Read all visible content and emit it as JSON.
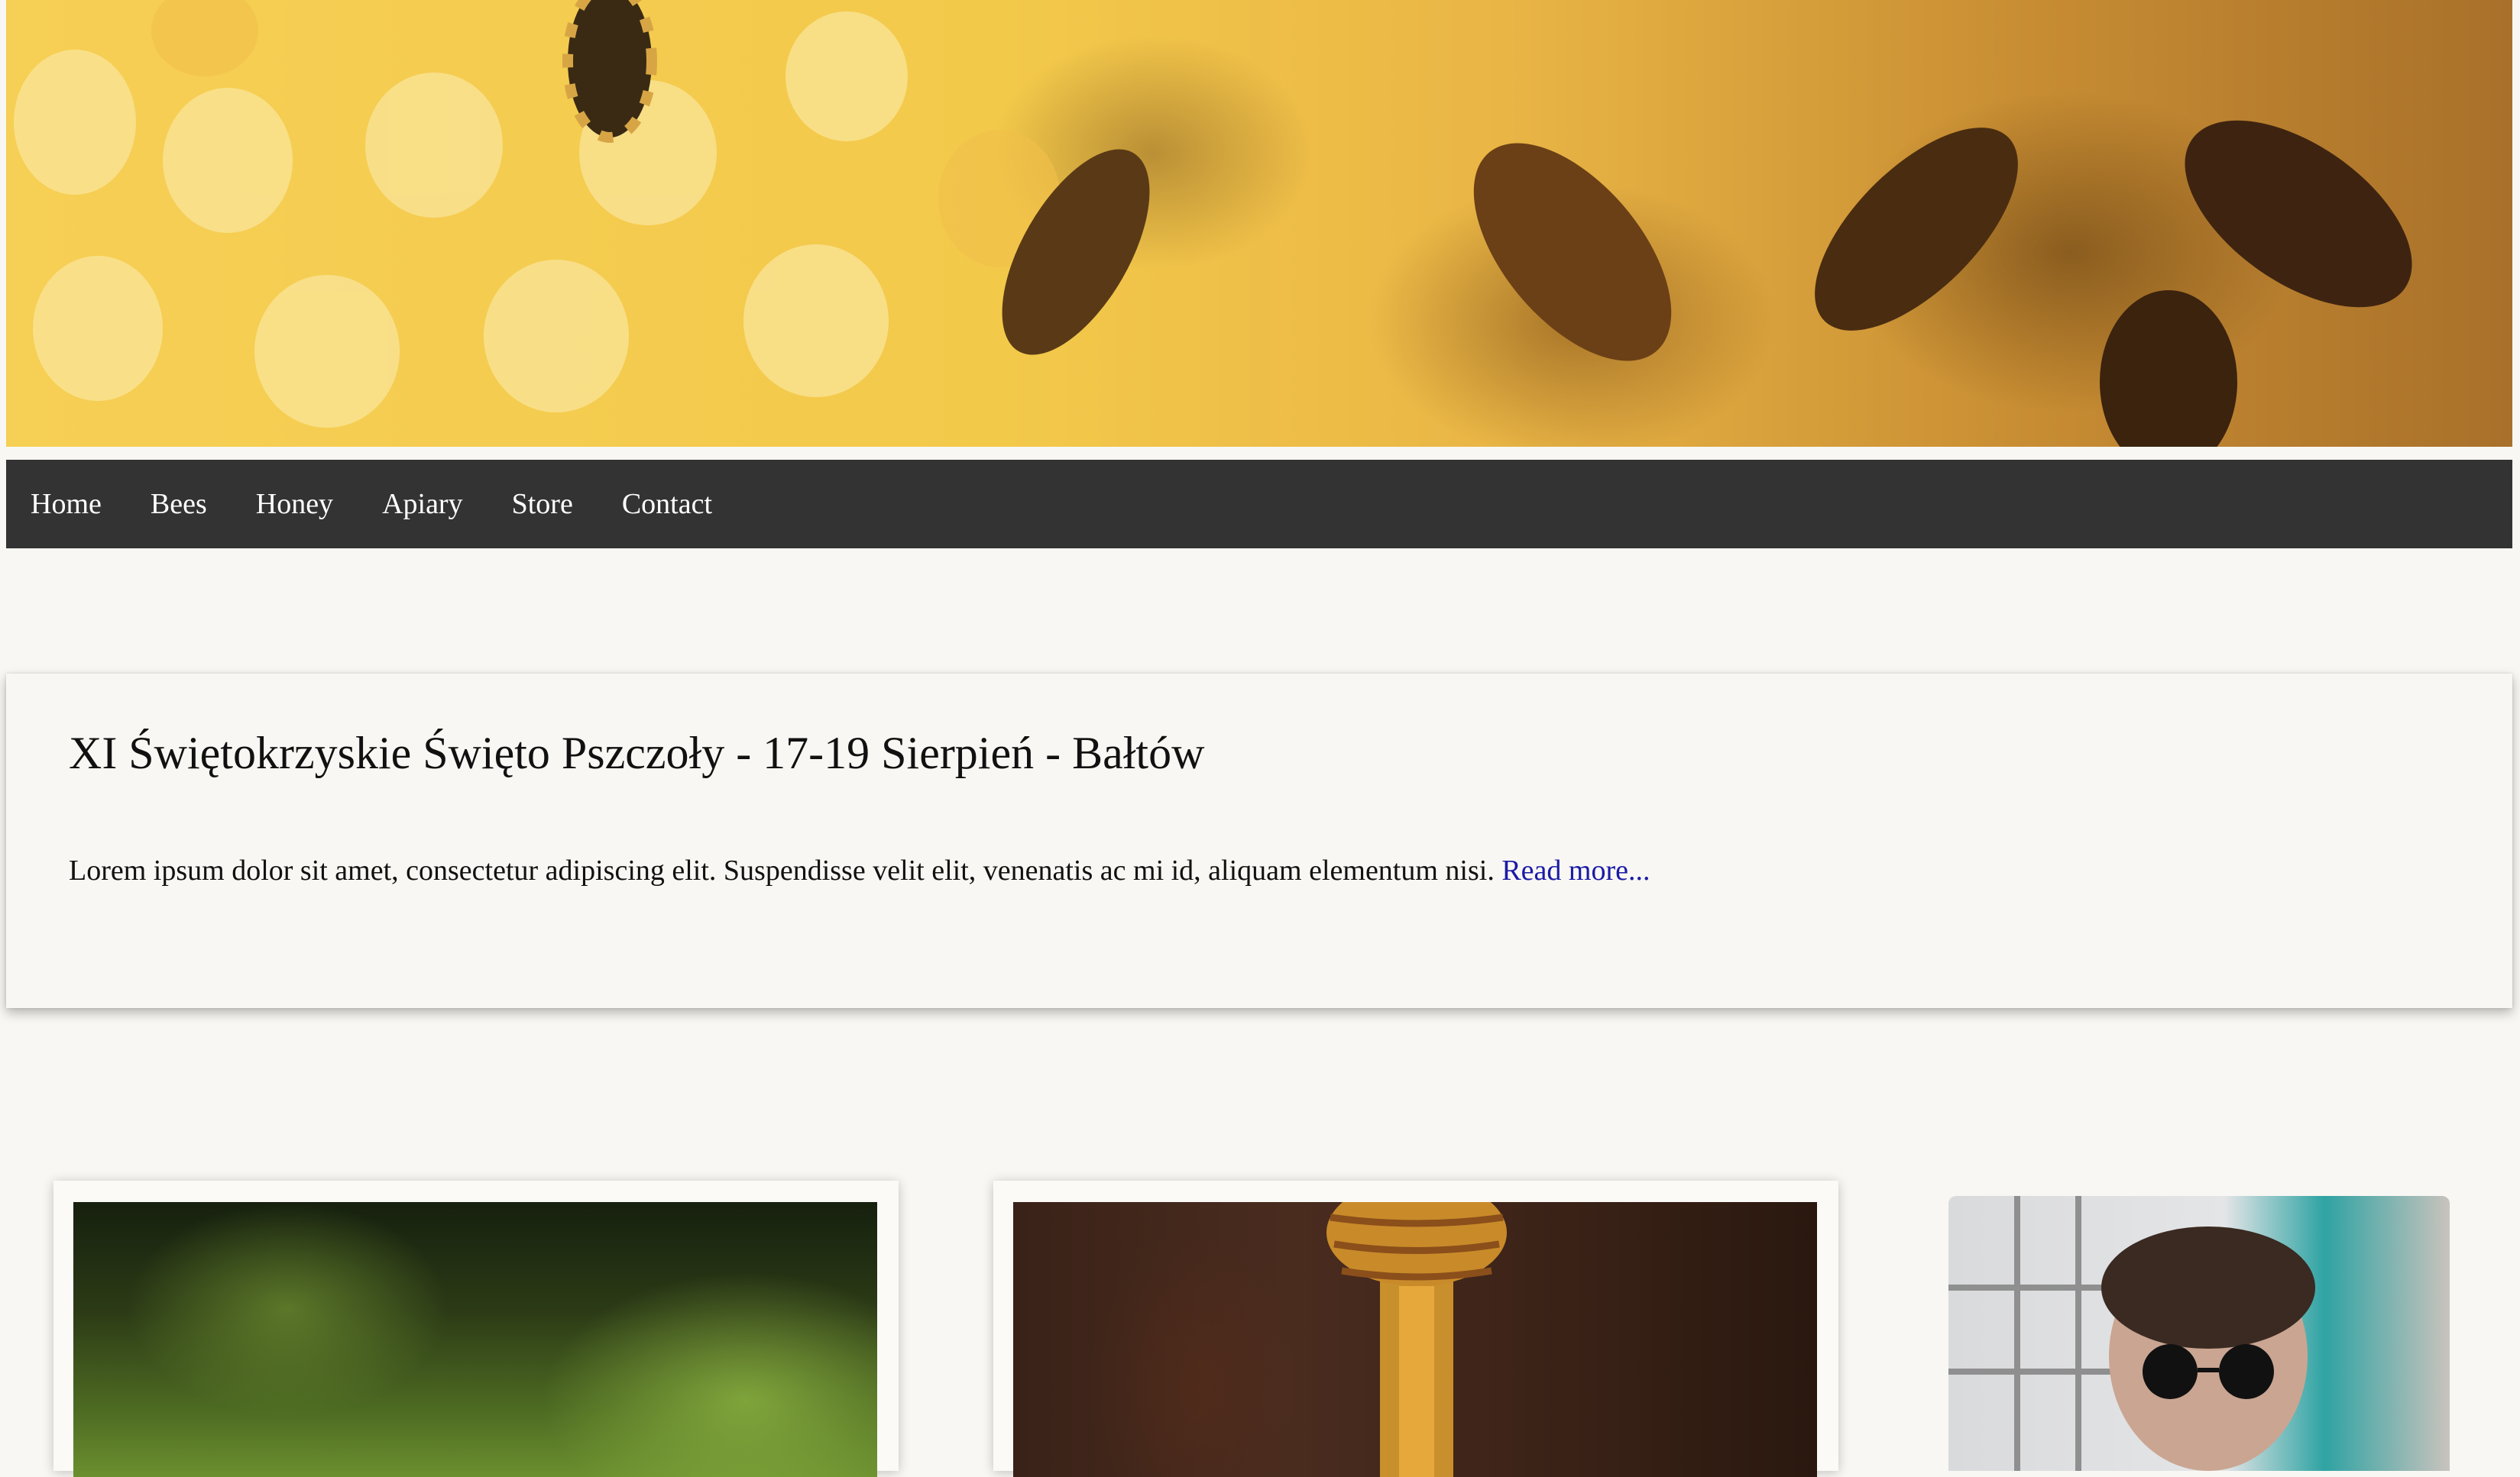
{
  "hero": {
    "image": "honeycomb-with-bees-photo"
  },
  "nav": {
    "items": [
      "Home",
      "Bees",
      "Honey",
      "Apiary",
      "Store",
      "Contact"
    ]
  },
  "announcement": {
    "title": "XI Świętokrzyskie Święto Pszczoły - 17-19 Sierpień - Bałtów",
    "body": "Lorem ipsum dolor sit amet, consectetur adipiscing elit. Suspendisse velit elit, venenatis ac mi id, aliquam elementum nisi.",
    "link": "Read more..."
  },
  "cards": [
    {
      "image": "green-nature-photo"
    },
    {
      "image": "honey-dipper-photo"
    },
    {
      "image": "person-with-sunglasses-photo"
    }
  ],
  "colors": {
    "page_bg": "#f8f7f3",
    "nav_bg": "#333333",
    "link": "#1a1aa6"
  }
}
